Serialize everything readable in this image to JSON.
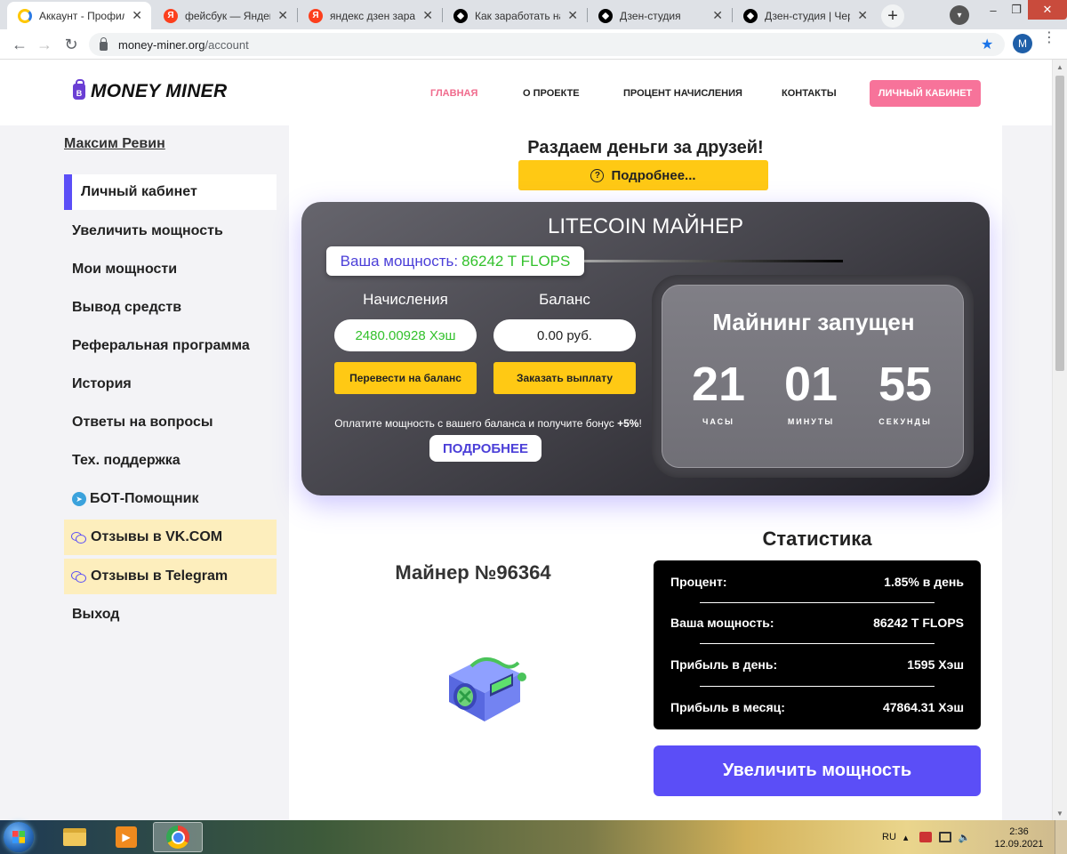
{
  "browser": {
    "tabs": [
      {
        "title": "Аккаунт - Профиль",
        "favicon": "money-miner-icon"
      },
      {
        "title": "фейсбук — Яндекс",
        "favicon": "yandex-icon"
      },
      {
        "title": "яндекс дзен зарабо",
        "favicon": "yandex-icon"
      },
      {
        "title": "Как заработать на Я",
        "favicon": "zen-icon"
      },
      {
        "title": "Дзен-студия",
        "favicon": "zen-icon"
      },
      {
        "title": "Дзен-студия | Черн",
        "favicon": "zen-icon"
      }
    ],
    "close_glyph": "✕",
    "new_tab_glyph": "+",
    "url_host": "money-miner.org",
    "url_path": "/account",
    "profile_initial": "M"
  },
  "site": {
    "logo_letter": "B",
    "logo_text": "MONEY MINER",
    "nav": [
      "ГЛАВНАЯ",
      "О ПРОЕКТЕ",
      "ПРОЦЕНТ НАЧИСЛЕНИЯ",
      "КОНТАКТЫ"
    ],
    "cabinet_button": "ЛИЧНЫЙ КАБИНЕТ",
    "accent_color": "#5b4ef7",
    "pink_color": "#f7739a",
    "yellow_color": "#ffc914"
  },
  "sidebar": {
    "user_name": "Максим Ревин",
    "items": [
      "Личный кабинет",
      "Увеличить мощность",
      "Мои мощности",
      "Вывод средств",
      "Реферальная программа",
      "История",
      "Ответы на вопросы",
      "Тех. поддержка",
      "БОТ-Помощник",
      "Отзывы в VK.COM",
      "Отзывы в Telegram",
      "Выход"
    ]
  },
  "promo": {
    "title": "Раздаем деньги за друзей!",
    "button": "Подробнее..."
  },
  "miner": {
    "title": "LITECOIN МАЙНЕР",
    "power_label": "Ваша мощность:",
    "power_value": "86242 T FLOPS",
    "accruals_label": "Начисления",
    "accruals_value": "2480.00928 Хэш",
    "balance_label": "Баланс",
    "balance_value": "0.00 руб.",
    "transfer_button": "Перевести на баланс",
    "payout_button": "Заказать выплату",
    "bonus_text": "Оплатите мощность с вашего баланса и получите бонус",
    "bonus_value": "+5%",
    "bonus_suffix": "!",
    "more_button": "ПОДРОБНЕЕ"
  },
  "timer": {
    "title": "Майнинг запущен",
    "hours": "21",
    "minutes": "01",
    "seconds": "55",
    "hours_label": "часы",
    "minutes_label": "минуты",
    "seconds_label": "секунды"
  },
  "miner_card": {
    "name": "Майнер №96364"
  },
  "stats": {
    "title": "Статистика",
    "rows": [
      {
        "label": "Процент:",
        "value": "1.85% в день"
      },
      {
        "label": "Ваша мощность:",
        "value": "86242 T FLOPS"
      },
      {
        "label": "Прибыль в день:",
        "value": "1595 Хэш"
      },
      {
        "label": "Прибыль в месяц:",
        "value": "47864.31 Хэш"
      }
    ],
    "increase_button": "Увеличить мощность"
  },
  "taskbar": {
    "lang": "RU",
    "time": "2:36",
    "date": "12.09.2021"
  }
}
